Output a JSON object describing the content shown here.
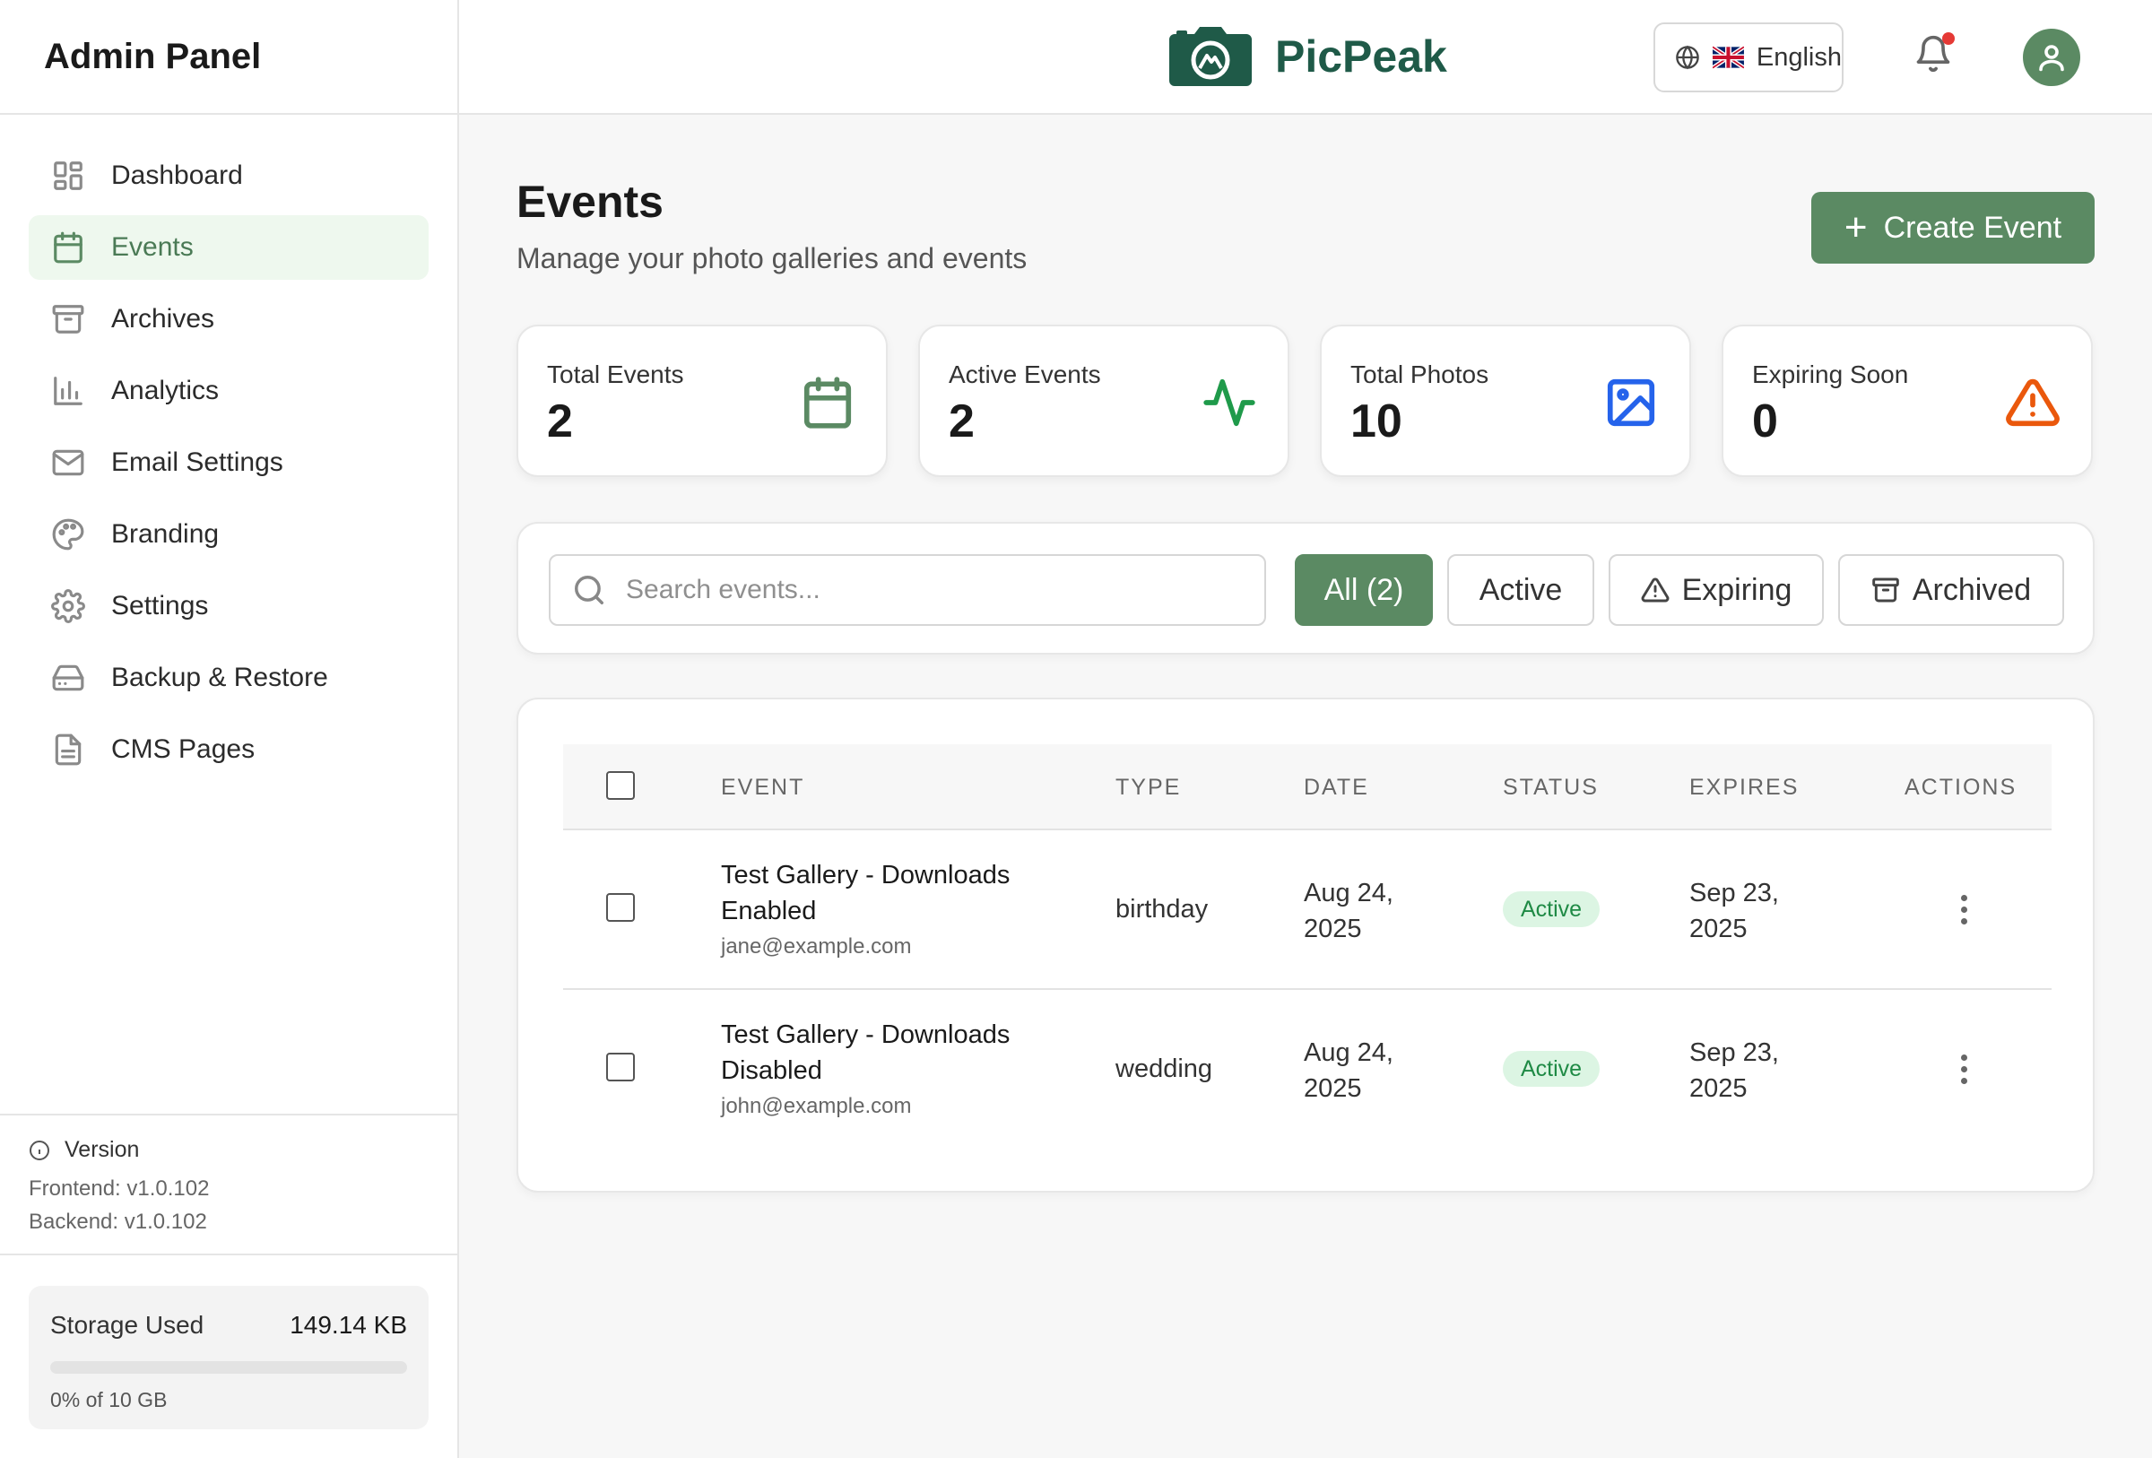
{
  "sidebar": {
    "title": "Admin Panel",
    "items": [
      {
        "label": "Dashboard",
        "icon": "dashboard-icon",
        "active": false
      },
      {
        "label": "Events",
        "icon": "calendar-icon",
        "active": true
      },
      {
        "label": "Archives",
        "icon": "archive-icon",
        "active": false
      },
      {
        "label": "Analytics",
        "icon": "bar-chart-icon",
        "active": false
      },
      {
        "label": "Email Settings",
        "icon": "mail-icon",
        "active": false
      },
      {
        "label": "Branding",
        "icon": "palette-icon",
        "active": false
      },
      {
        "label": "Settings",
        "icon": "gear-icon",
        "active": false
      },
      {
        "label": "Backup & Restore",
        "icon": "hard-drive-icon",
        "active": false
      },
      {
        "label": "CMS Pages",
        "icon": "file-text-icon",
        "active": false
      }
    ],
    "version": {
      "label": "Version",
      "frontend": "Frontend: v1.0.102",
      "backend": "Backend: v1.0.102"
    },
    "storage": {
      "label": "Storage Used",
      "value": "149.14 KB",
      "percent_text": "0% of 10 GB",
      "percent": 0
    }
  },
  "header": {
    "brand": "PicPeak",
    "language": "English",
    "notification_dot": true
  },
  "page": {
    "title": "Events",
    "subtitle": "Manage your photo galleries and events",
    "create_label": "Create Event"
  },
  "stats": [
    {
      "label": "Total Events",
      "value": "2",
      "icon": "calendar-icon",
      "color": "#5b8a63"
    },
    {
      "label": "Active Events",
      "value": "2",
      "icon": "activity-icon",
      "color": "#1f9a4a"
    },
    {
      "label": "Total Photos",
      "value": "10",
      "icon": "image-icon",
      "color": "#2563eb"
    },
    {
      "label": "Expiring Soon",
      "value": "0",
      "icon": "warning-icon",
      "color": "#ea580c"
    }
  ],
  "filters": {
    "search_placeholder": "Search events...",
    "tabs": [
      {
        "label": "All (2)",
        "active": true
      },
      {
        "label": "Active",
        "active": false
      },
      {
        "label": "Expiring",
        "active": false,
        "icon": "warning-icon"
      },
      {
        "label": "Archived",
        "active": false,
        "icon": "archive-icon"
      }
    ]
  },
  "table": {
    "columns": [
      "EVENT",
      "TYPE",
      "DATE",
      "STATUS",
      "EXPIRES",
      "ACTIONS"
    ],
    "rows": [
      {
        "name": "Test Gallery - Downloads Enabled",
        "email": "jane@example.com",
        "type": "birthday",
        "date": "Aug 24, 2025",
        "status": "Active",
        "expires": "Sep 23, 2025"
      },
      {
        "name": "Test Gallery - Downloads Disabled",
        "email": "john@example.com",
        "type": "wedding",
        "date": "Aug 24, 2025",
        "status": "Active",
        "expires": "Sep 23, 2025"
      }
    ]
  }
}
